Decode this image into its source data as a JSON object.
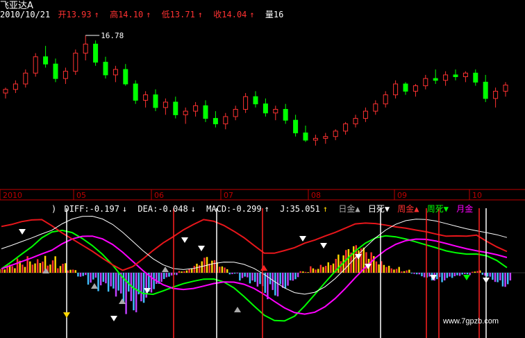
{
  "header": {
    "stock_name": "飞亚达A",
    "date": "2010/10/21",
    "open_label": "开13.93",
    "high_label": "高14.10",
    "low_label": "低13.71",
    "close_label": "收14.04",
    "volume_label": "量16",
    "arrow": "↑"
  },
  "peak_price_label": "16.78",
  "indicator": {
    "paren": ")",
    "diff": "DIFF:-0.197",
    "dea": "DEA:-0.048",
    "macd": "MACD:-0.299",
    "j": "J:35.051",
    "down_arrow": "↓",
    "up_arrow": "↑",
    "rijin": "日金▲",
    "risi": "日死▼",
    "zhoujin": "周金▲",
    "zhousi": "周死▼",
    "yuejin": "月金"
  },
  "watermark": "www.7gpzb.com",
  "colors": {
    "up": "#ff3232",
    "down": "#54ffff",
    "green": "#00ff00",
    "red": "#e8161b",
    "diff": "#00ff00",
    "dea": "#ff00ff",
    "macd_pos_a": "#ff3030",
    "macd_pos_b": "#ffd700",
    "macd_neg_a": "#40c0ff",
    "macd_neg_b": "#c040ff"
  },
  "chart_data": [
    {
      "type": "candlestick",
      "title": "飞亚达A",
      "x_ticks": [
        "2010",
        "05",
        "06",
        "07",
        "08",
        "09",
        "10"
      ],
      "price_labels": [
        "16.78"
      ],
      "ohlc_approx": [
        [
          13.6,
          13.9,
          13.3,
          13.8
        ],
        [
          13.8,
          14.3,
          13.6,
          14.1
        ],
        [
          14.1,
          14.9,
          13.9,
          14.7
        ],
        [
          14.7,
          15.8,
          14.5,
          15.6
        ],
        [
          15.6,
          16.2,
          15.0,
          15.2
        ],
        [
          15.2,
          15.5,
          14.2,
          14.4
        ],
        [
          14.4,
          15.0,
          14.1,
          14.8
        ],
        [
          14.8,
          16.0,
          14.6,
          15.8
        ],
        [
          15.8,
          16.78,
          15.4,
          16.3
        ],
        [
          16.3,
          16.5,
          15.1,
          15.3
        ],
        [
          15.3,
          15.6,
          14.4,
          14.6
        ],
        [
          14.6,
          15.1,
          14.2,
          14.9
        ],
        [
          14.9,
          15.2,
          14.0,
          14.1
        ],
        [
          14.1,
          14.3,
          13.0,
          13.2
        ],
        [
          13.2,
          13.7,
          12.8,
          13.5
        ],
        [
          13.5,
          13.8,
          12.6,
          12.8
        ],
        [
          12.8,
          13.3,
          12.4,
          13.1
        ],
        [
          13.1,
          13.4,
          12.2,
          12.4
        ],
        [
          12.4,
          12.8,
          11.9,
          12.6
        ],
        [
          12.6,
          13.1,
          12.3,
          12.9
        ],
        [
          12.9,
          13.2,
          12.0,
          12.2
        ],
        [
          12.2,
          12.6,
          11.7,
          11.9
        ],
        [
          11.9,
          12.5,
          11.6,
          12.3
        ],
        [
          12.3,
          12.9,
          12.1,
          12.7
        ],
        [
          12.7,
          13.6,
          12.5,
          13.4
        ],
        [
          13.4,
          13.7,
          12.8,
          13.0
        ],
        [
          13.0,
          13.3,
          12.3,
          12.5
        ],
        [
          12.5,
          12.9,
          12.1,
          12.7
        ],
        [
          12.7,
          13.0,
          11.9,
          12.1
        ],
        [
          12.1,
          12.4,
          11.2,
          11.4
        ],
        [
          11.4,
          11.8,
          10.9,
          11.0
        ],
        [
          11.0,
          11.3,
          10.7,
          11.1
        ],
        [
          11.1,
          11.4,
          10.8,
          11.2
        ],
        [
          11.2,
          11.6,
          11.0,
          11.5
        ],
        [
          11.5,
          12.0,
          11.3,
          11.9
        ],
        [
          11.9,
          12.4,
          11.7,
          12.2
        ],
        [
          12.2,
          12.8,
          12.0,
          12.6
        ],
        [
          12.6,
          13.2,
          12.4,
          13.0
        ],
        [
          13.0,
          13.7,
          12.8,
          13.5
        ],
        [
          13.5,
          14.3,
          13.3,
          14.1
        ],
        [
          14.1,
          14.2,
          13.5,
          13.7
        ],
        [
          13.7,
          14.1,
          13.4,
          14.0
        ],
        [
          14.0,
          14.6,
          13.8,
          14.4
        ],
        [
          14.4,
          14.9,
          14.1,
          14.3
        ],
        [
          14.3,
          14.8,
          14.0,
          14.6
        ],
        [
          14.6,
          14.9,
          14.3,
          14.5
        ],
        [
          14.5,
          14.8,
          14.2,
          14.7
        ],
        [
          14.7,
          14.9,
          14.0,
          14.2
        ],
        [
          14.2,
          14.6,
          13.1,
          13.3
        ],
        [
          13.3,
          13.9,
          12.8,
          13.7
        ],
        [
          13.7,
          14.2,
          13.4,
          14.04
        ]
      ]
    },
    {
      "type": "bar",
      "title": "MACD",
      "series": [
        {
          "name": "DIFF",
          "values": [
            -0.197
          ]
        },
        {
          "name": "DEA",
          "values": [
            -0.048
          ]
        },
        {
          "name": "MACD",
          "values": [
            -0.299
          ]
        },
        {
          "name": "J",
          "values": [
            35.051
          ]
        }
      ],
      "macd_hist_approx": [
        0.05,
        0.1,
        0.18,
        0.25,
        0.3,
        0.22,
        0.12,
        0.04,
        -0.05,
        -0.15,
        -0.28,
        -0.42,
        -0.55,
        -0.5,
        -0.38,
        -0.25,
        -0.14,
        -0.06,
        0.04,
        0.12,
        0.2,
        0.16,
        0.08,
        -0.02,
        -0.12,
        -0.24,
        -0.35,
        -0.3,
        -0.2,
        -0.1,
        0.02,
        0.1,
        0.18,
        0.24,
        0.3,
        0.35,
        0.32,
        0.26,
        0.18,
        0.1,
        0.04,
        -0.02,
        -0.06,
        -0.1,
        -0.12,
        -0.08,
        -0.04,
        0.03,
        -0.05,
        -0.12,
        -0.18
      ],
      "legend": [
        "日金▲",
        "日死▼",
        "周金▲",
        "周死▼",
        "月金"
      ]
    }
  ]
}
